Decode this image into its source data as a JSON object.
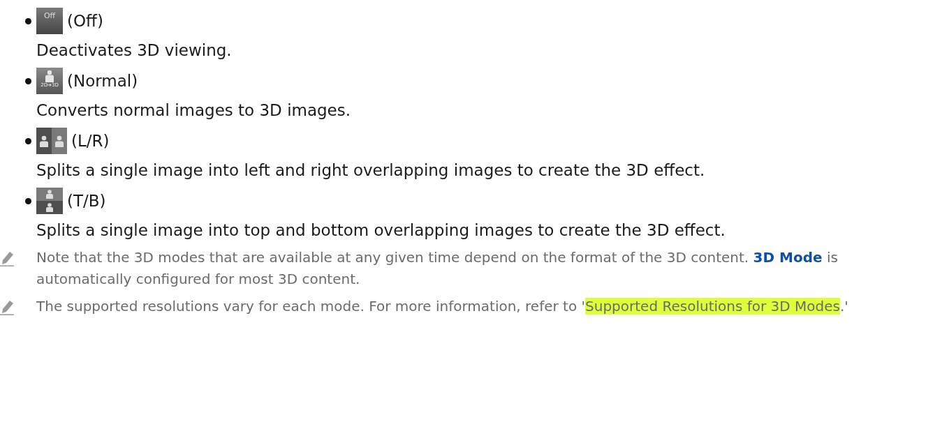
{
  "modes": [
    {
      "kind": "off",
      "icon_text": "Off",
      "label": "(Off)",
      "description": "Deactivates 3D viewing."
    },
    {
      "kind": "normal",
      "icon_text": "2D➔3D",
      "label": "(Normal)",
      "description": "Converts normal images to 3D images."
    },
    {
      "kind": "lr",
      "label": "(L/R)",
      "description": "Splits a single image into left and right overlapping images to create the 3D effect."
    },
    {
      "kind": "tb",
      "label": "(T/B)",
      "description": "Splits a single image into top and bottom overlapping images to create the 3D effect."
    }
  ],
  "notes": [
    {
      "parts": [
        {
          "kind": "plain",
          "text": "Note that the 3D modes that are available at any given time depend on the format of the 3D content. "
        },
        {
          "kind": "term",
          "text": "3D Mode"
        },
        {
          "kind": "plain",
          "text": " is automatically configured for most 3D content."
        }
      ]
    },
    {
      "parts": [
        {
          "kind": "plain",
          "text": "The supported resolutions vary for each mode. For more information, refer to '"
        },
        {
          "kind": "link",
          "text": "Supported Resolutions for 3D Modes"
        },
        {
          "kind": "plain",
          "text": ".'"
        }
      ]
    }
  ]
}
